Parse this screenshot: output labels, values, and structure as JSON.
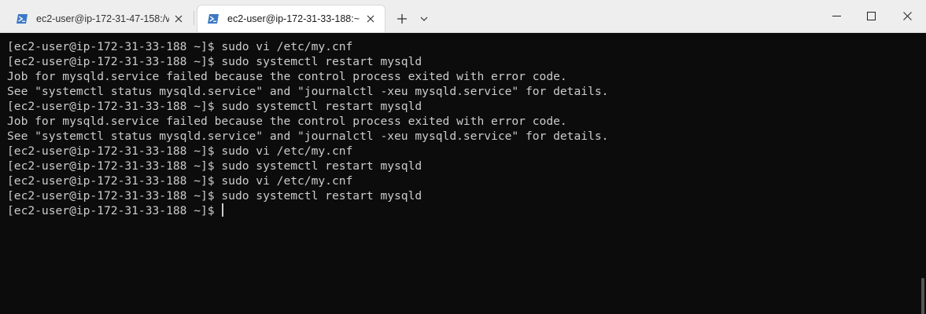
{
  "tabs": [
    {
      "title": "ec2-user@ip-172-31-47-158:/v",
      "active": false
    },
    {
      "title": "ec2-user@ip-172-31-33-188:~",
      "active": true
    }
  ],
  "colors": {
    "terminal_bg": "#0c0c0c",
    "terminal_fg": "#cccccc",
    "titlebar_bg": "#eeeeee",
    "powershell_icon": "#3b78c4"
  },
  "terminal": {
    "lines": [
      "[ec2-user@ip-172-31-33-188 ~]$ sudo vi /etc/my.cnf",
      "[ec2-user@ip-172-31-33-188 ~]$ sudo systemctl restart mysqld",
      "Job for mysqld.service failed because the control process exited with error code.",
      "See \"systemctl status mysqld.service\" and \"journalctl -xeu mysqld.service\" for details.",
      "[ec2-user@ip-172-31-33-188 ~]$ sudo systemctl restart mysqld",
      "Job for mysqld.service failed because the control process exited with error code.",
      "See \"systemctl status mysqld.service\" and \"journalctl -xeu mysqld.service\" for details.",
      "[ec2-user@ip-172-31-33-188 ~]$ sudo vi /etc/my.cnf",
      "[ec2-user@ip-172-31-33-188 ~]$ sudo systemctl restart mysqld",
      "[ec2-user@ip-172-31-33-188 ~]$ sudo vi /etc/my.cnf",
      "[ec2-user@ip-172-31-33-188 ~]$ sudo systemctl restart mysqld"
    ],
    "current_prompt": "[ec2-user@ip-172-31-33-188 ~]$ "
  }
}
